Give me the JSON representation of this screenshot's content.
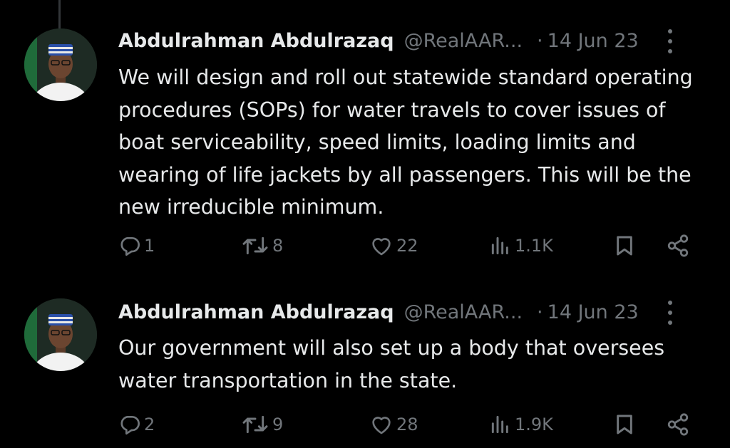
{
  "tweets": [
    {
      "name": "Abdulrahman Abdulrazaq",
      "handle": "@RealAAR...",
      "separator": "·",
      "date": "14 Jun 23",
      "text": "We will design and roll out statewide standard operating procedures (SOPs) for water travels to cover issues of boat serviceability, speed limits, loading limits and wearing of life jackets by all passengers. This will be the new irreducible minimum.",
      "replies": "1",
      "retweets": "8",
      "likes": "22",
      "views": "1.1K"
    },
    {
      "name": "Abdulrahman Abdulrazaq",
      "handle": "@RealAAR...",
      "separator": "·",
      "date": "14 Jun 23",
      "text": "Our government will also set up a body that oversees water transportation in the state.",
      "replies": "2",
      "retweets": "9",
      "likes": "28",
      "views": "1.9K"
    }
  ],
  "icons": {
    "reply": "reply-icon",
    "retweet": "retweet-icon",
    "like": "heart-icon",
    "views": "views-icon",
    "bookmark": "bookmark-icon",
    "share": "share-icon",
    "more": "more-icon"
  },
  "colors": {
    "background": "#000000",
    "text": "#e7e9ea",
    "muted": "#71767b"
  }
}
